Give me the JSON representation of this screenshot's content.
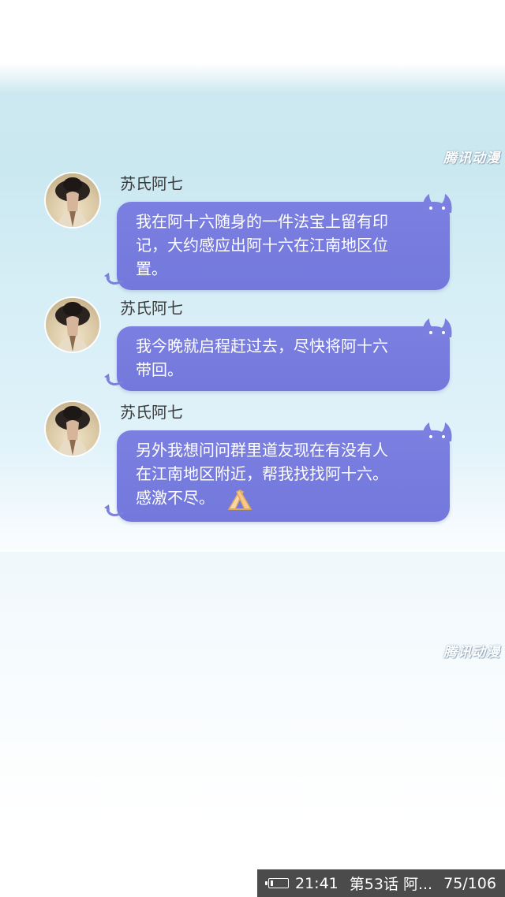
{
  "watermark": "腾讯动漫",
  "messages": [
    {
      "sender": "苏氏阿七",
      "text": "我在阿十六随身的一件法宝上留有印\n记，大约感应出阿十六在江南地区位\n置。"
    },
    {
      "sender": "苏氏阿七",
      "text": "我今晚就启程赶过去，尽快将阿十六\n带回。"
    },
    {
      "sender": "苏氏阿七",
      "text": "另外我想问问群里道友现在有没有人\n在江南地区附近，帮我找找阿十六。\n感激不尽。",
      "emoji": "clap-hands-icon"
    }
  ],
  "status_bar": {
    "time": "21:41",
    "chapter": "第53话 阿...",
    "page": "75/106"
  },
  "colors": {
    "bubble": "#7b7fe0",
    "sender_text": "#3a3a3a",
    "status_bar_bg": "#3c3c3c"
  }
}
